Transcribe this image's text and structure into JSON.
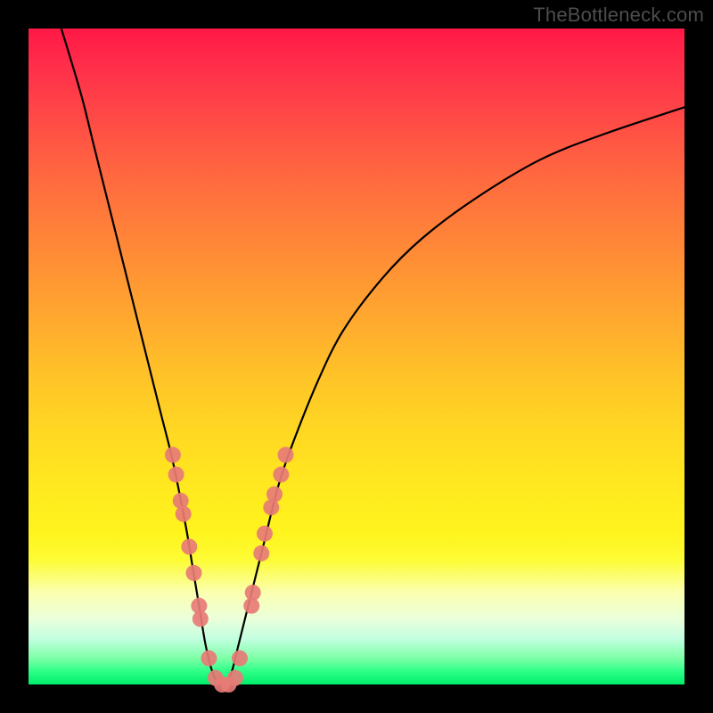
{
  "watermark": "TheBottleneck.com",
  "chart_data": {
    "type": "line",
    "title": "",
    "xlabel": "",
    "ylabel": "",
    "xlim": [
      0,
      100
    ],
    "ylim": [
      0,
      100
    ],
    "grid": false,
    "legend": false,
    "series": [
      {
        "name": "bottleneck-curve",
        "color": "#000000",
        "x": [
          5,
          8,
          10,
          12,
          14,
          16,
          18,
          20,
          22,
          24,
          25,
          26,
          27,
          28,
          29,
          30,
          31,
          32,
          34,
          36,
          38,
          40,
          44,
          48,
          54,
          60,
          68,
          78,
          88,
          100
        ],
        "y": [
          100,
          90,
          82,
          74,
          66,
          58,
          50,
          42,
          34,
          24,
          18,
          12,
          6,
          2,
          0,
          0,
          2,
          6,
          14,
          22,
          30,
          36,
          46,
          54,
          62,
          68,
          74,
          80,
          84,
          88
        ]
      }
    ],
    "markers": {
      "name": "highlighted-points",
      "color": "#e77b76",
      "radius": 9,
      "points": [
        {
          "x": 22.0,
          "y": 35
        },
        {
          "x": 22.5,
          "y": 32
        },
        {
          "x": 23.2,
          "y": 28
        },
        {
          "x": 23.6,
          "y": 26
        },
        {
          "x": 24.5,
          "y": 21
        },
        {
          "x": 25.2,
          "y": 17
        },
        {
          "x": 26.0,
          "y": 12
        },
        {
          "x": 26.2,
          "y": 10
        },
        {
          "x": 27.5,
          "y": 4
        },
        {
          "x": 28.5,
          "y": 1
        },
        {
          "x": 29.5,
          "y": 0
        },
        {
          "x": 30.5,
          "y": 0
        },
        {
          "x": 31.5,
          "y": 1
        },
        {
          "x": 32.2,
          "y": 4
        },
        {
          "x": 34.0,
          "y": 12
        },
        {
          "x": 34.2,
          "y": 14
        },
        {
          "x": 35.5,
          "y": 20
        },
        {
          "x": 36.0,
          "y": 23
        },
        {
          "x": 37.0,
          "y": 27
        },
        {
          "x": 37.5,
          "y": 29
        },
        {
          "x": 38.5,
          "y": 32
        },
        {
          "x": 39.2,
          "y": 35
        }
      ]
    },
    "background_gradient": {
      "top": "#ff1846",
      "mid": "#ffd922",
      "bottom": "#00ed6a"
    }
  }
}
